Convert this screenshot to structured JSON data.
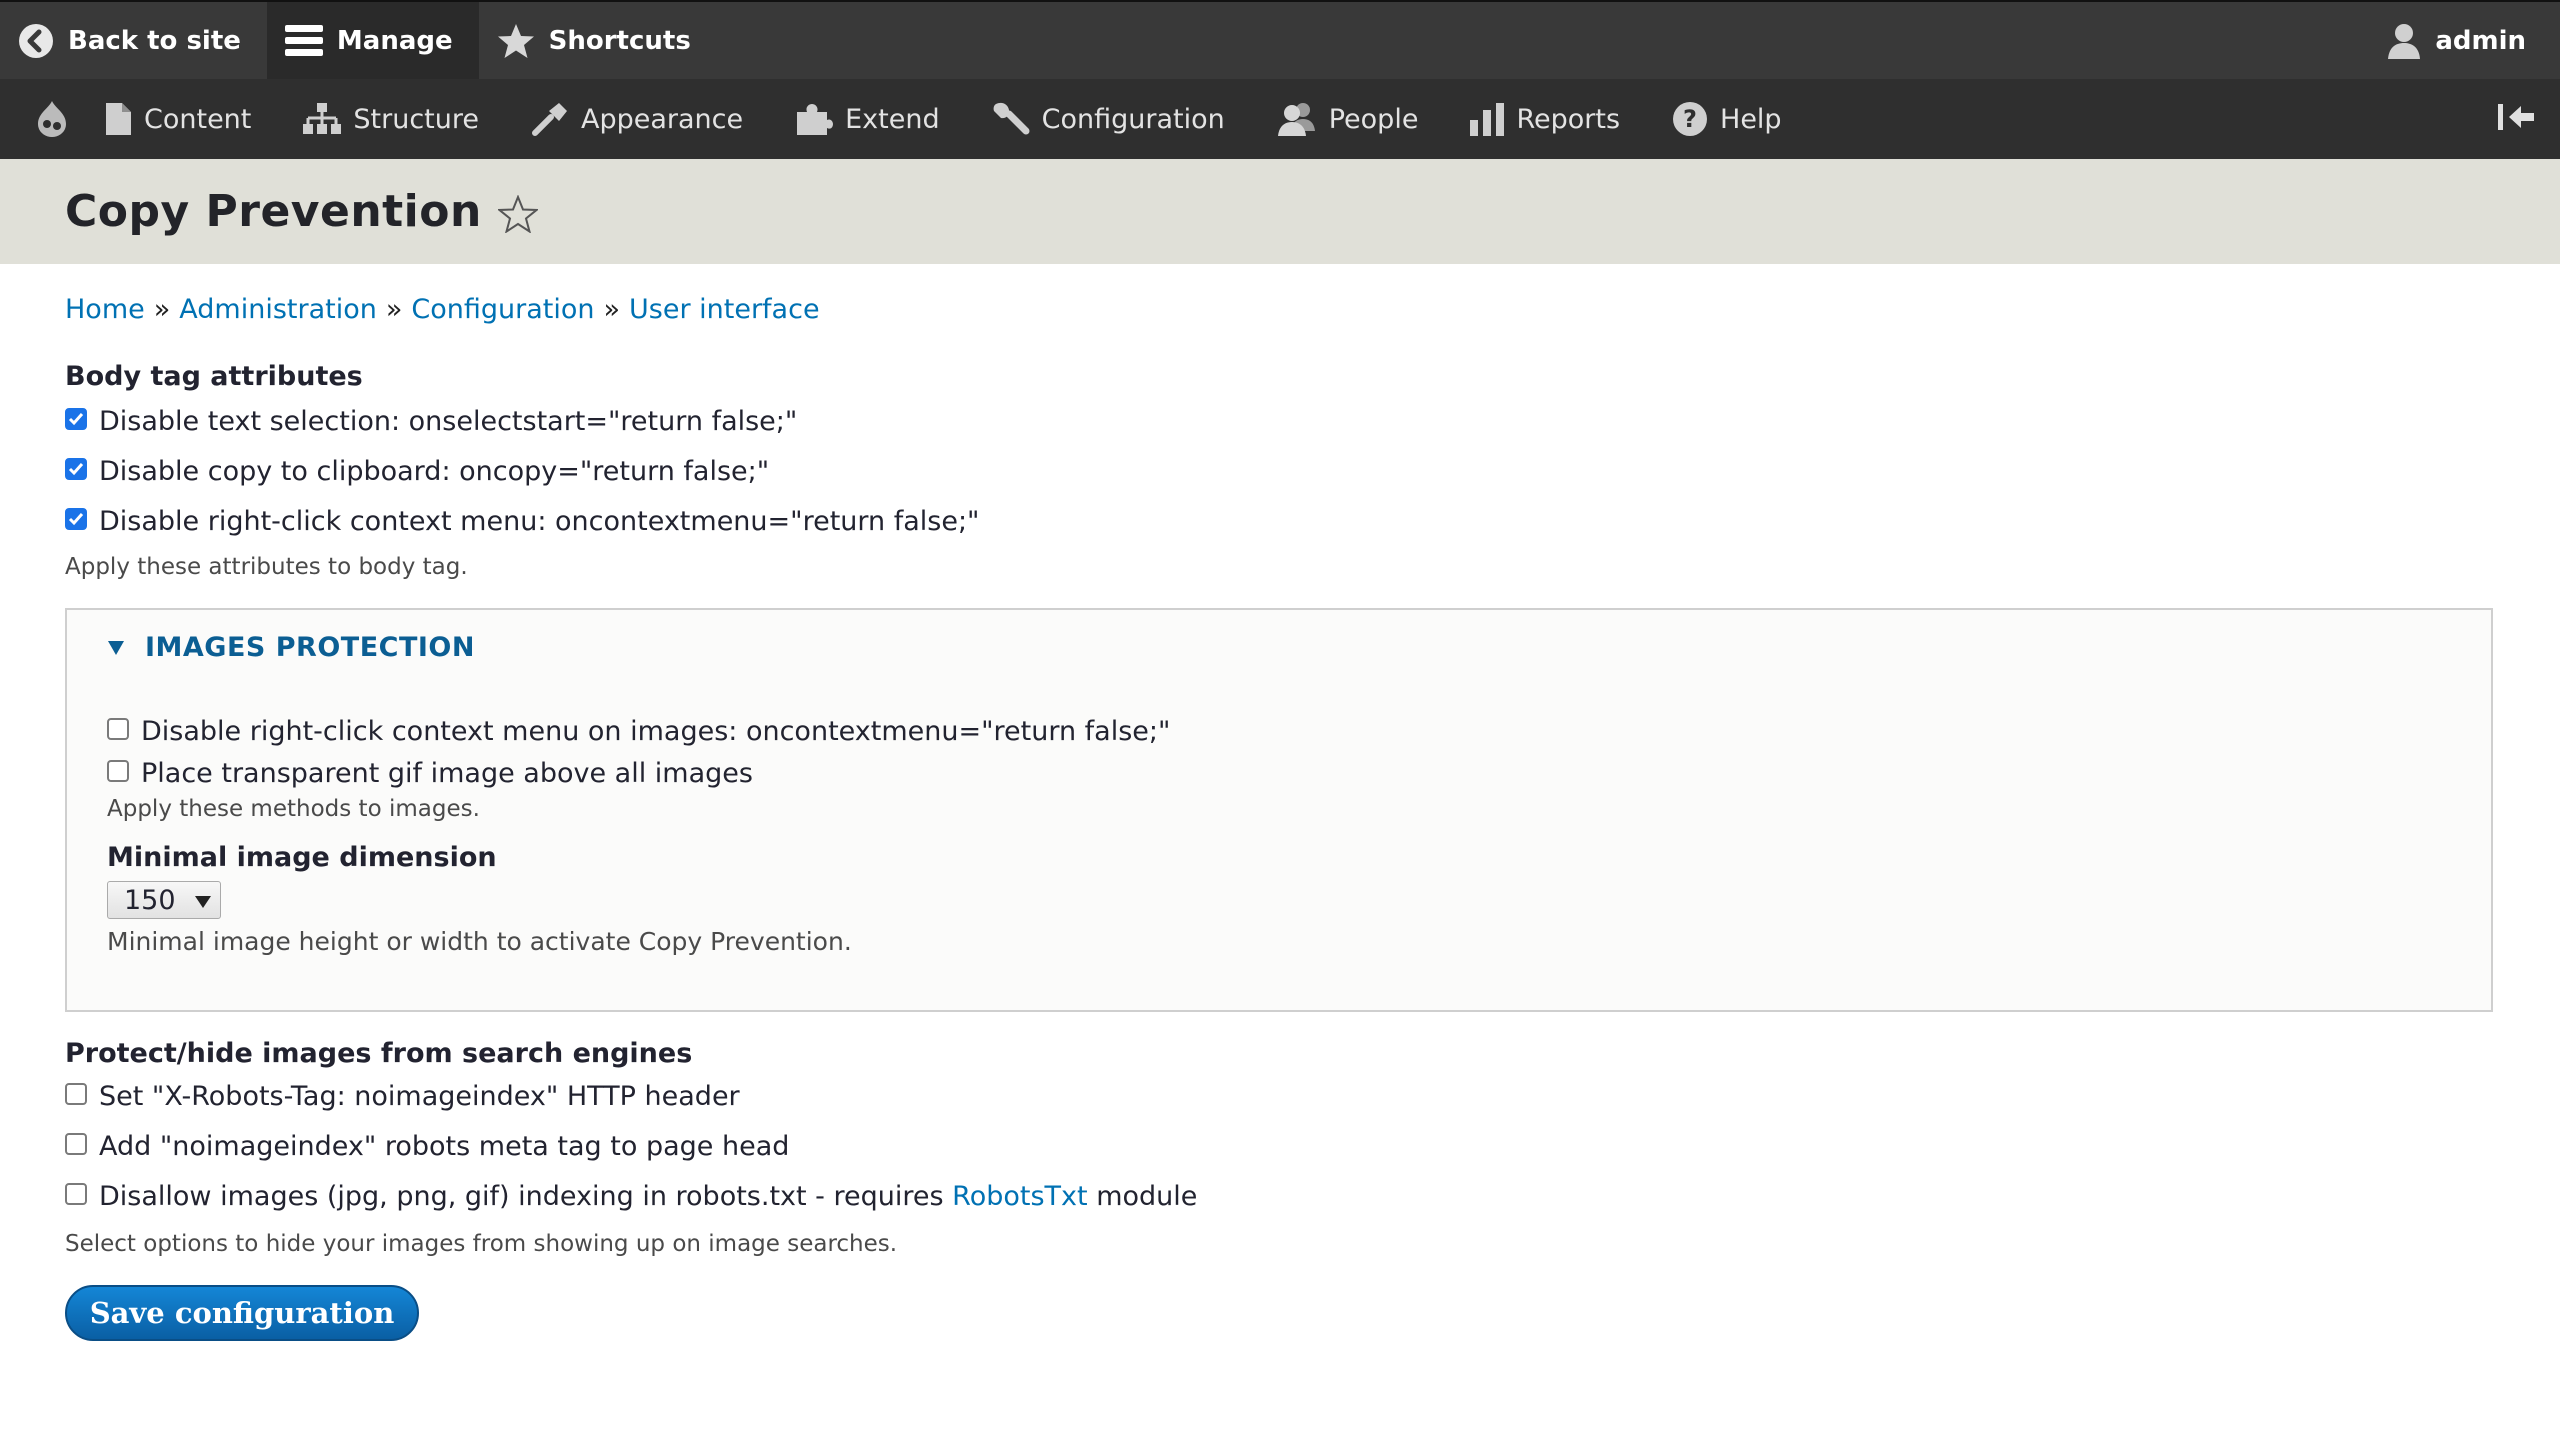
{
  "toolbar": {
    "back_label": "Back to site",
    "manage_label": "Manage",
    "shortcuts_label": "Shortcuts",
    "user_label": "admin"
  },
  "menu": {
    "items": [
      {
        "label": "Content",
        "icon": "file-icon"
      },
      {
        "label": "Structure",
        "icon": "sitemap-icon"
      },
      {
        "label": "Appearance",
        "icon": "brush-icon"
      },
      {
        "label": "Extend",
        "icon": "puzzle-icon"
      },
      {
        "label": "Configuration",
        "icon": "wrench-icon"
      },
      {
        "label": "People",
        "icon": "people-icon"
      },
      {
        "label": "Reports",
        "icon": "bar-chart-icon"
      },
      {
        "label": "Help",
        "icon": "help-icon"
      }
    ]
  },
  "page": {
    "title": "Copy Prevention"
  },
  "breadcrumb": {
    "items": [
      "Home",
      "Administration",
      "Configuration",
      "User interface"
    ],
    "separator": "»"
  },
  "body_attrs": {
    "label": "Body tag attributes",
    "options": [
      {
        "label": "Disable text selection: onselectstart=\"return false;\"",
        "checked": true
      },
      {
        "label": "Disable copy to clipboard: oncopy=\"return false;\"",
        "checked": true
      },
      {
        "label": "Disable right-click context menu: oncontextmenu=\"return false;\"",
        "checked": true
      }
    ],
    "description": "Apply these attributes to body tag."
  },
  "images": {
    "legend": "IMAGES PROTECTION",
    "options": [
      {
        "label": "Disable right-click context menu on images: oncontextmenu=\"return false;\"",
        "checked": false
      },
      {
        "label": "Place transparent gif image above all images",
        "checked": false
      }
    ],
    "description": "Apply these methods to images.",
    "min_dim_label": "Minimal image dimension",
    "min_dim_value": "150",
    "min_dim_description": "Minimal image height or width to activate Copy Prevention."
  },
  "search": {
    "label": "Protect/hide images from search engines",
    "options": [
      {
        "label": "Set \"X-Robots-Tag: noimageindex\" HTTP header",
        "checked": false
      },
      {
        "label": "Add \"noimageindex\" robots meta tag to page head",
        "checked": false
      }
    ],
    "robots_prefix": "Disallow images (jpg, png, gif) indexing in robots.txt - requires",
    "robots_link": "RobotsTxt",
    "robots_suffix": "module",
    "robots_checked": false,
    "description": "Select options to hide your images from showing up on image searches."
  },
  "actions": {
    "save_label": "Save configuration"
  },
  "colors": {
    "toolbar_dark": "#393939",
    "header_bg": "#e0e0d8",
    "link": "#0071b3",
    "button": "#0a5fa4",
    "checked": "#1a73e8"
  }
}
